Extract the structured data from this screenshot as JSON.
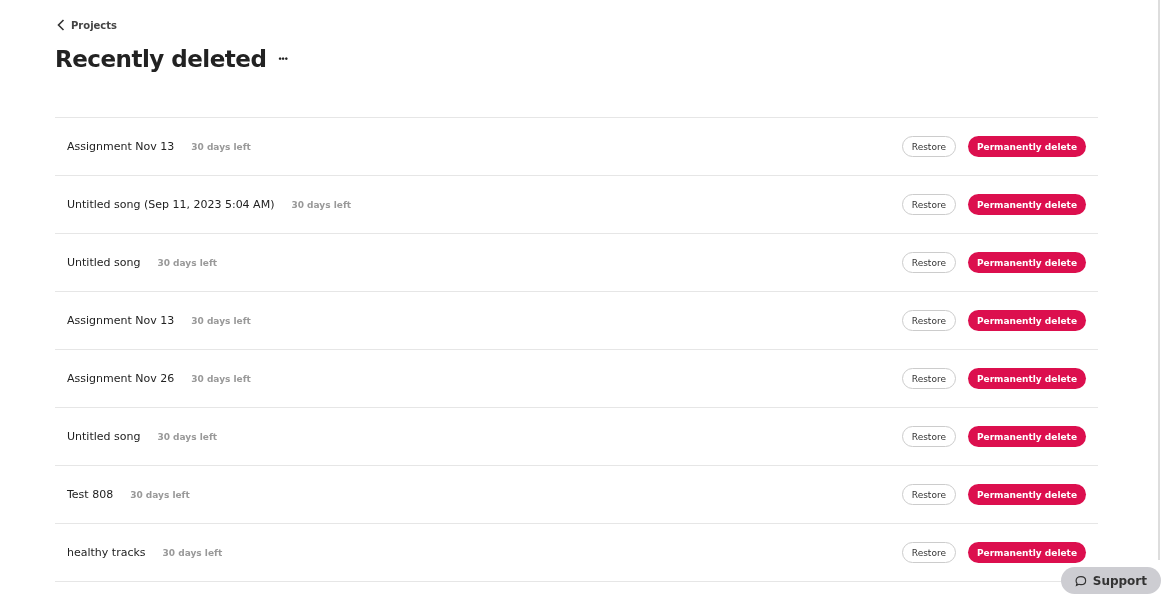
{
  "back_link": {
    "label": "Projects"
  },
  "title": "Recently deleted",
  "more_button": {
    "label": "•••"
  },
  "items": [
    {
      "name": "Assignment Nov 13",
      "time_left": "30 days left",
      "restore": "Restore",
      "delete": "Permanently delete"
    },
    {
      "name": "Untitled song (Sep 11, 2023 5:04 AM)",
      "time_left": "30 days left",
      "restore": "Restore",
      "delete": "Permanently delete"
    },
    {
      "name": "Untitled song",
      "time_left": "30 days left",
      "restore": "Restore",
      "delete": "Permanently delete"
    },
    {
      "name": "Assignment Nov 13",
      "time_left": "30 days left",
      "restore": "Restore",
      "delete": "Permanently delete"
    },
    {
      "name": "Assignment Nov 26",
      "time_left": "30 days left",
      "restore": "Restore",
      "delete": "Permanently delete"
    },
    {
      "name": "Untitled song",
      "time_left": "30 days left",
      "restore": "Restore",
      "delete": "Permanently delete"
    },
    {
      "name": "Test 808",
      "time_left": "30 days left",
      "restore": "Restore",
      "delete": "Permanently delete"
    },
    {
      "name": "healthy tracks",
      "time_left": "30 days left",
      "restore": "Restore",
      "delete": "Permanently delete"
    }
  ],
  "support_button": {
    "label": "Support"
  }
}
